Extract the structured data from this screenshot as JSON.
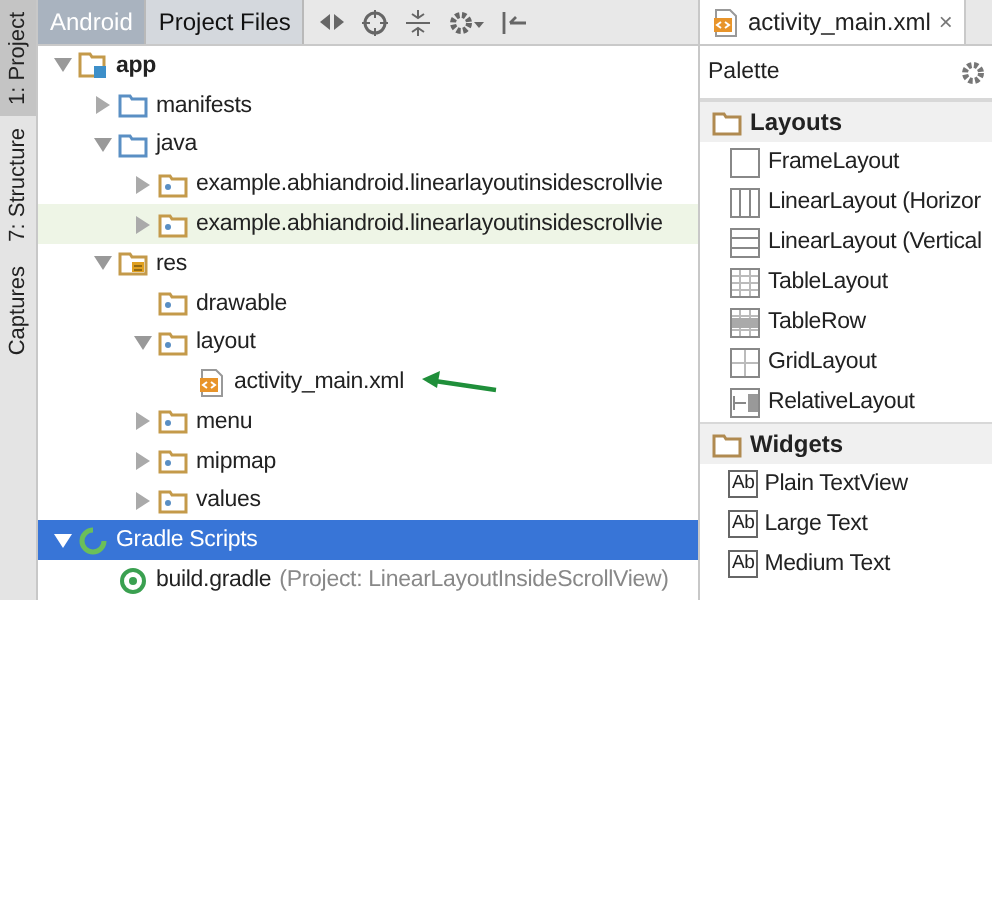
{
  "side_strip": [
    {
      "label": "1: Project",
      "selected": true
    },
    {
      "label": "7: Structure",
      "selected": false
    },
    {
      "label": "Captures",
      "selected": false
    }
  ],
  "project_tabs": [
    {
      "label": "Android",
      "selected": true
    },
    {
      "label": "Project Files",
      "selected": false
    }
  ],
  "tree": [
    {
      "label": "app",
      "kind": "module",
      "bold": true,
      "expanded": true,
      "children": [
        {
          "label": "manifests",
          "kind": "folder",
          "expanded": false
        },
        {
          "label": "java",
          "kind": "folder",
          "expanded": true,
          "children": [
            {
              "label": "example.abhiandroid.linearlayoutinsidescrollvie",
              "kind": "package",
              "expanded": false
            },
            {
              "label": "example.abhiandroid.linearlayoutinsidescrollvie",
              "kind": "package",
              "expanded": false,
              "highlighted": true
            }
          ]
        },
        {
          "label": "res",
          "kind": "res",
          "expanded": true,
          "children": [
            {
              "label": "drawable",
              "kind": "package"
            },
            {
              "label": "layout",
              "kind": "package",
              "expanded": true,
              "children": [
                {
                  "label": "activity_main.xml",
                  "kind": "xml",
                  "pointer_arrow": true
                }
              ]
            },
            {
              "label": "menu",
              "kind": "package",
              "expanded": false
            },
            {
              "label": "mipmap",
              "kind": "package",
              "expanded": false
            },
            {
              "label": "values",
              "kind": "package",
              "expanded": false
            }
          ]
        }
      ]
    },
    {
      "label": "Gradle Scripts",
      "kind": "gradle_group",
      "expanded": true,
      "selected": true,
      "children": [
        {
          "label": "build.gradle",
          "kind": "gradle",
          "note": "(Project: LinearLayoutInsideScrollView)"
        }
      ]
    }
  ],
  "editor_tab": {
    "label": "activity_main.xml",
    "close": "×"
  },
  "palette": {
    "title": "Palette",
    "sections": [
      {
        "title": "Layouts",
        "items": [
          {
            "label": "FrameLayout",
            "kind": "frame"
          },
          {
            "label": "LinearLayout (Horizor",
            "kind": "linear_h"
          },
          {
            "label": "LinearLayout (Vertical",
            "kind": "linear_v"
          },
          {
            "label": "TableLayout",
            "kind": "table"
          },
          {
            "label": "TableRow",
            "kind": "table_row"
          },
          {
            "label": "GridLayout",
            "kind": "grid"
          },
          {
            "label": "RelativeLayout",
            "kind": "relative"
          }
        ]
      },
      {
        "title": "Widgets",
        "items": [
          {
            "label": "Plain TextView",
            "kind": "text",
            "badge": "Ab"
          },
          {
            "label": "Large Text",
            "kind": "text",
            "badge": "Ab"
          },
          {
            "label": "Medium Text",
            "kind": "text",
            "badge": "Ab"
          }
        ]
      }
    ]
  }
}
